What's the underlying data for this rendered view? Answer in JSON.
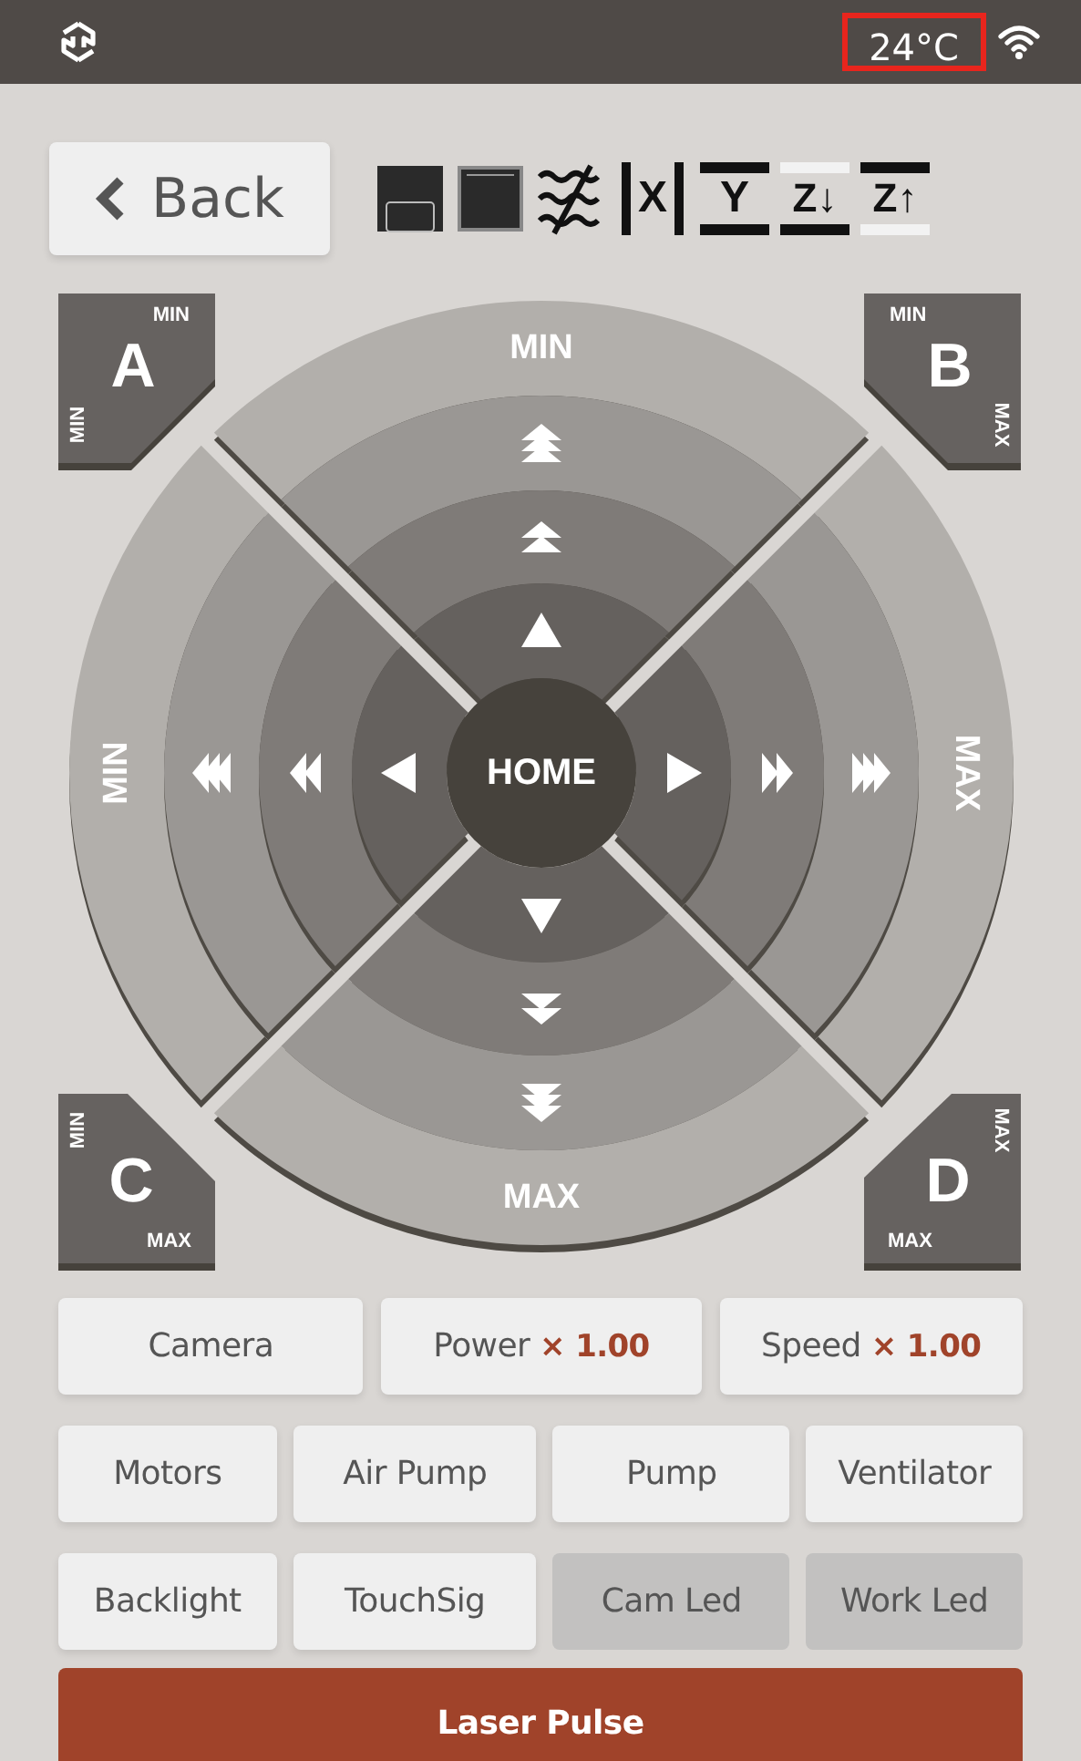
{
  "status_bar": {
    "temperature": "24°C",
    "temperature_highlighted": true
  },
  "back_button": {
    "label": "Back"
  },
  "toolbar": [
    {
      "kind": "filled-square"
    },
    {
      "kind": "square-frame"
    },
    {
      "kind": "wave-off"
    },
    {
      "kind": "x-axis",
      "label": "X"
    },
    {
      "kind": "y-axis",
      "label": "Y"
    },
    {
      "kind": "z-down",
      "label": "Z↓"
    },
    {
      "kind": "z-up",
      "label": "Z↑"
    }
  ],
  "jog_pad": {
    "home": "HOME",
    "directions": [
      {
        "kind": "up",
        "end_label": "MIN"
      },
      {
        "kind": "right",
        "end_label": "MAX"
      },
      {
        "kind": "down",
        "end_label": "MAX"
      },
      {
        "kind": "left",
        "end_label": "MIN"
      }
    ]
  },
  "corners": [
    {
      "kind": "top-left",
      "letter": "A",
      "h_label": "MIN",
      "v_label": "MIN"
    },
    {
      "kind": "top-right",
      "letter": "B",
      "h_label": "MIN",
      "v_label": "MAX"
    },
    {
      "kind": "bottom-left",
      "letter": "C",
      "h_label": "MAX",
      "v_label": "MIN"
    },
    {
      "kind": "bottom-right",
      "letter": "D",
      "h_label": "MAX",
      "v_label": "MAX"
    }
  ],
  "controls": [
    [
      {
        "label": "Camera",
        "active": false
      },
      {
        "label": "Power",
        "value": "× 1.00",
        "active": false
      },
      {
        "label": "Speed",
        "value": "× 1.00",
        "active": false
      }
    ],
    [
      {
        "label": "Motors",
        "active": false
      },
      {
        "label": "Air Pump",
        "active": false
      },
      {
        "label": "Pump",
        "active": false
      },
      {
        "label": "Ventilator",
        "active": false
      }
    ],
    [
      {
        "label": "Backlight",
        "active": false
      },
      {
        "label": "TouchSig",
        "active": false
      },
      {
        "label": "Cam Led",
        "active": true
      },
      {
        "label": "Work Led",
        "active": true
      }
    ]
  ],
  "laser_pulse": {
    "label": "Laser Pulse"
  }
}
